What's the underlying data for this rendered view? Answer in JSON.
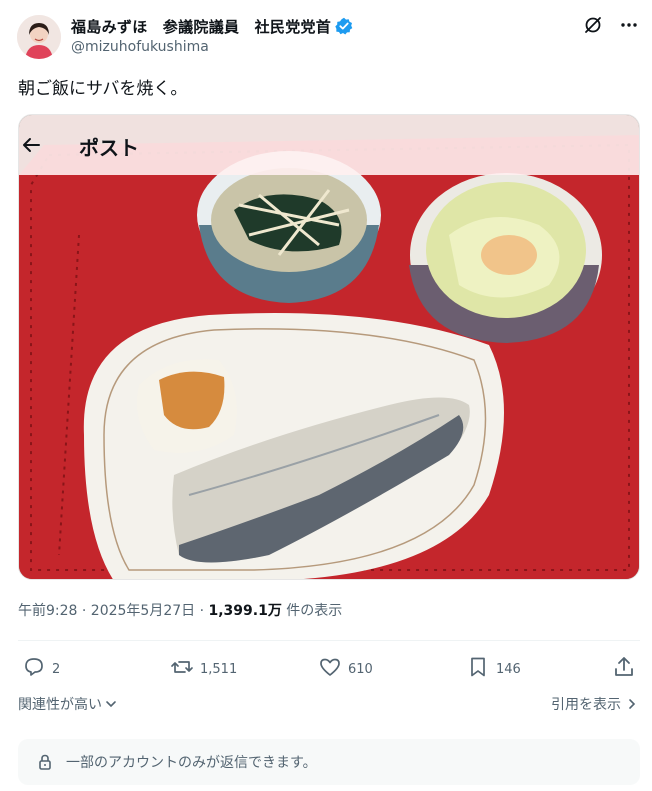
{
  "author": {
    "display_name": "福島みずほ　参議院議員　社民党党首",
    "handle": "@mizuhofukushima",
    "verified_color": "#1d9bf0"
  },
  "header_icons": [
    "grok-icon",
    "more-icon"
  ],
  "tweet": {
    "text": "朝ご飯にサバを焼く。"
  },
  "media_overlay": {
    "title": "ポスト"
  },
  "meta": {
    "time_date": "午前9:28 · 2025年5月27日 · ",
    "views": "1,399.1万",
    "views_suffix": " 件の表示"
  },
  "actions": {
    "reply_count": "2",
    "retweet_count": "1,511",
    "like_count": "610",
    "bookmark_count": "146"
  },
  "sort": {
    "relevance_label": "関連性が高い",
    "quotes_label": "引用を表示"
  },
  "reply_notice": {
    "text": "一部のアカウントのみが返信できます。"
  },
  "colors": {
    "text": "#0f1419",
    "secondary": "#536471",
    "placemat_red": "#c4262c"
  }
}
